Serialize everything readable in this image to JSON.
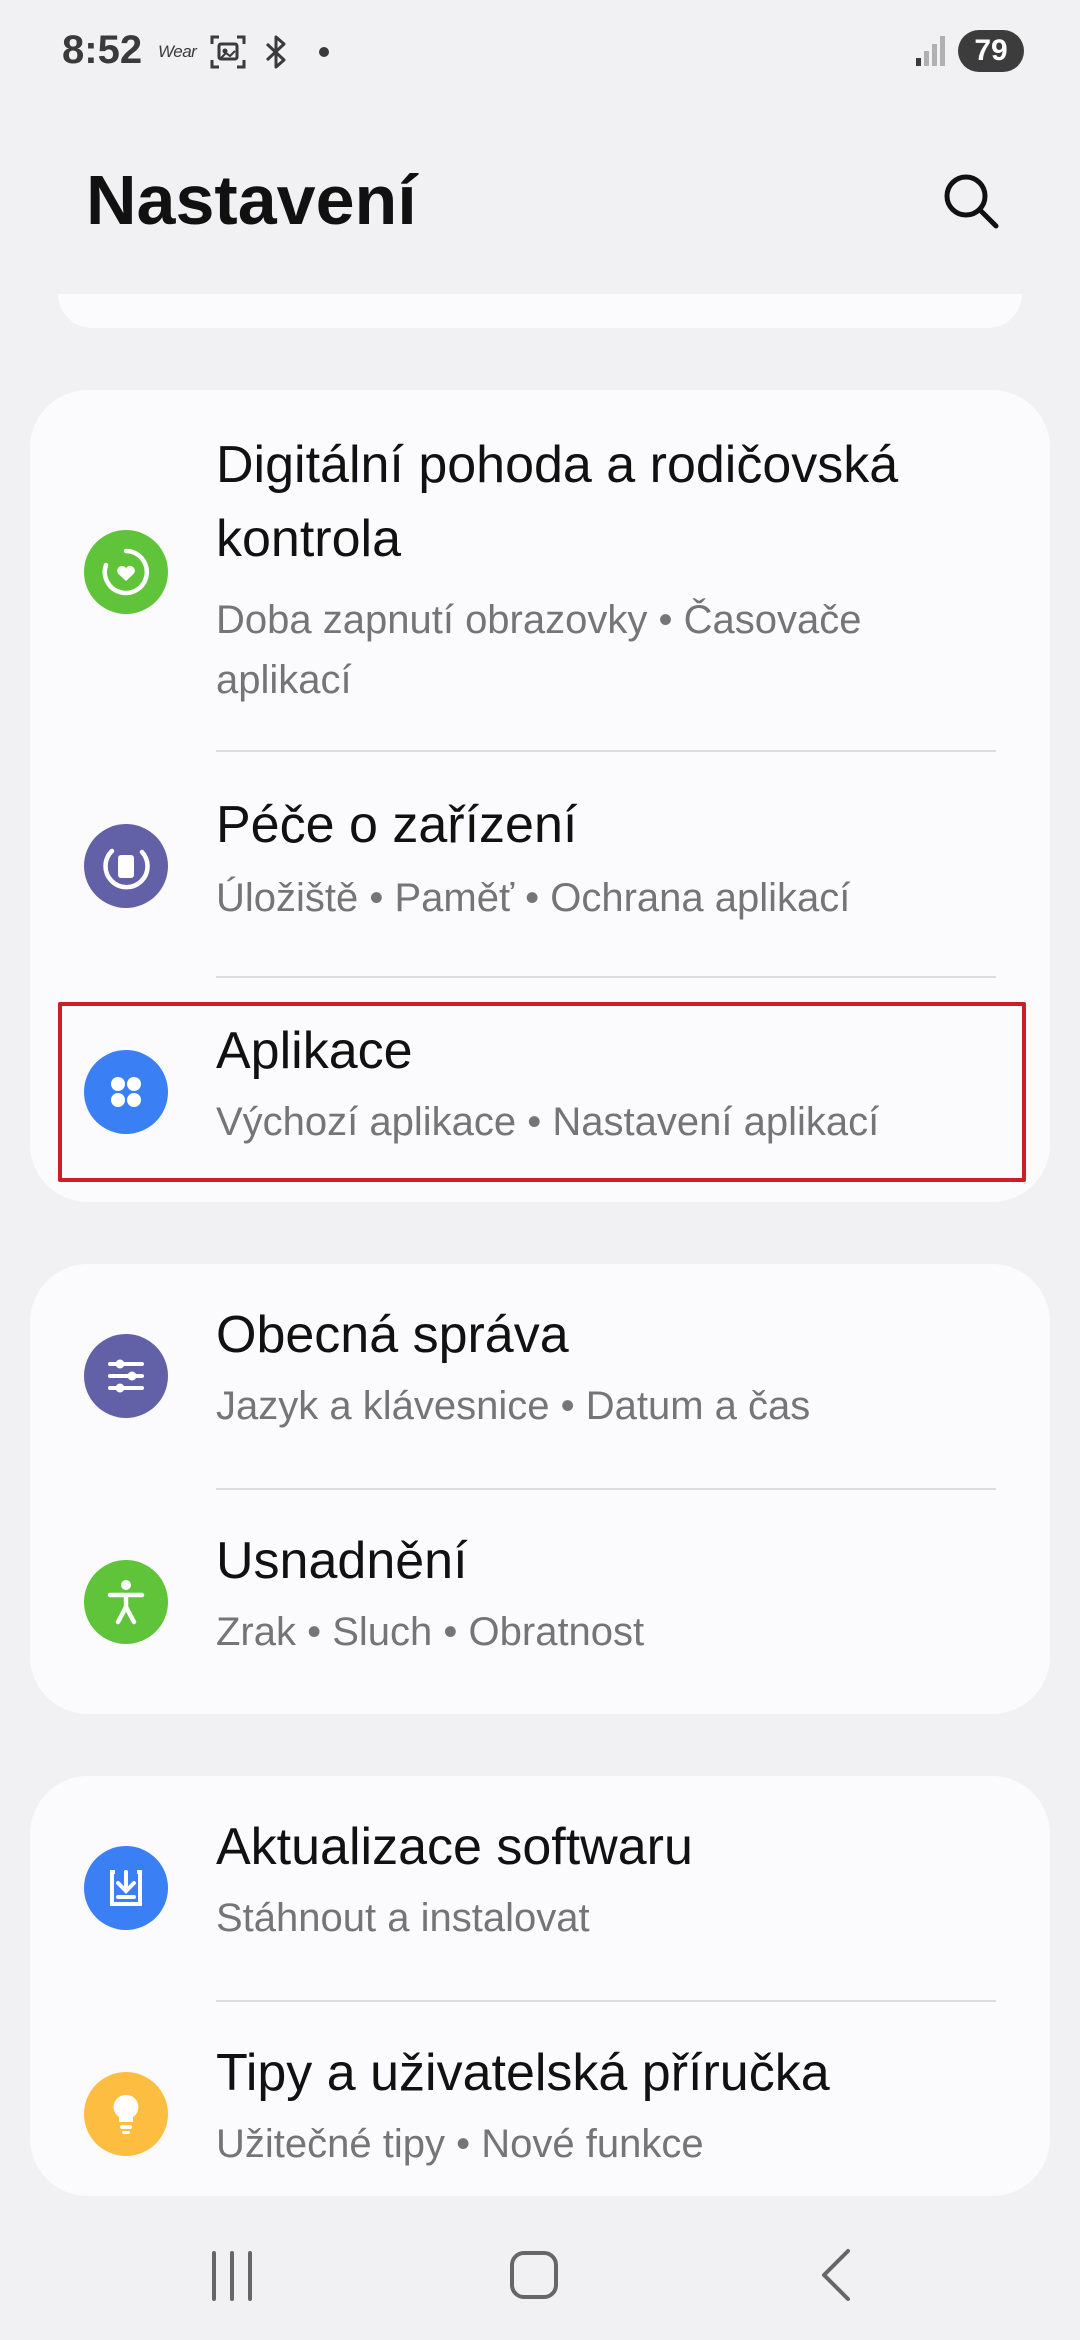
{
  "status_bar": {
    "time": "8:52",
    "wear_label": "Wear",
    "battery": "79",
    "icons": [
      "wear-icon",
      "screenshot-icon",
      "bluetooth-icon",
      "dot-icon",
      "signal-icon",
      "battery-icon"
    ]
  },
  "header": {
    "title": "Nastavení",
    "search_icon": "search-icon"
  },
  "groups": [
    {
      "items": [
        {
          "title_line1": "Digitální pohoda a rodičovská",
          "title_line2": "kontrola",
          "subtitle_line1": "Doba zapnutí obrazovky  •  Časovače",
          "subtitle_line2": "aplikací",
          "icon": "digital-wellbeing-icon",
          "icon_color": "#5fc43a"
        },
        {
          "title": "Péče o zařízení",
          "subtitle": "Úložiště  •  Paměť  •  Ochrana aplikací",
          "icon": "device-care-icon",
          "icon_color": "#6261a8"
        },
        {
          "title": "Aplikace",
          "subtitle": "Výchozí aplikace  •  Nastavení aplikací",
          "icon": "apps-icon",
          "icon_color": "#3b7ff4",
          "highlighted": true
        }
      ]
    },
    {
      "items": [
        {
          "title": "Obecná správa",
          "subtitle": "Jazyk a klávesnice  •  Datum a čas",
          "icon": "general-management-icon",
          "icon_color": "#6261a8"
        },
        {
          "title": "Usnadnění",
          "subtitle": "Zrak  •  Sluch  •  Obratnost",
          "icon": "accessibility-icon",
          "icon_color": "#5fc43a"
        }
      ]
    },
    {
      "items": [
        {
          "title": "Aktualizace softwaru",
          "subtitle": "Stáhnout a instalovat",
          "icon": "software-update-icon",
          "icon_color": "#3b7ff4"
        },
        {
          "title": "Tipy a uživatelská příručka",
          "subtitle": "Užitečné tipy  •  Nové funkce",
          "icon": "tips-icon",
          "icon_color": "#fdbd40"
        }
      ]
    }
  ],
  "nav_bar": {
    "icons": [
      "recent-apps-icon",
      "home-icon",
      "back-icon"
    ]
  }
}
